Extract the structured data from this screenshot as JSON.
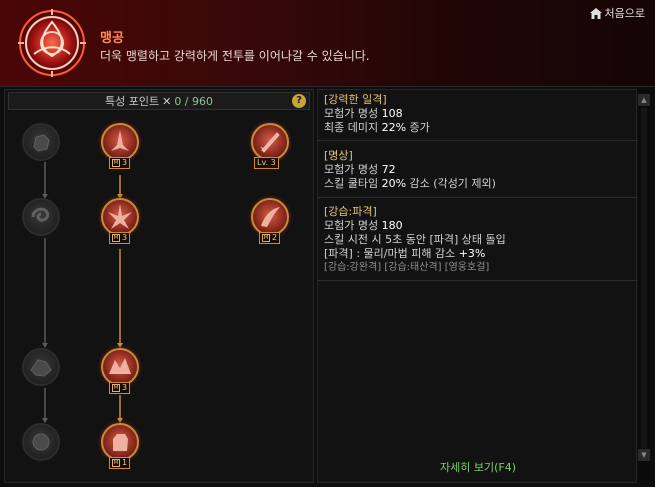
{
  "header": {
    "title": "맹공",
    "description": "더욱 맹렬하고 강력하게 전투를 이어나갈 수 있습니다.",
    "home_label": "처음으로"
  },
  "points": {
    "label": "특성 포인트",
    "value": "0 / 960",
    "help": "?"
  },
  "tree_nodes": [
    {
      "name": "gray-1-1",
      "state": "inactive"
    },
    {
      "name": "red-1-2",
      "state": "active",
      "badge": "3",
      "badge_prefix": "M"
    },
    {
      "name": "red-1-3",
      "state": "active",
      "badge": "Lv. 3"
    },
    {
      "name": "gray-2-1",
      "state": "inactive"
    },
    {
      "name": "red-2-2",
      "state": "active",
      "badge": "3",
      "badge_prefix": "M"
    },
    {
      "name": "red-2-3",
      "state": "active",
      "badge": "2",
      "badge_prefix": "M"
    },
    {
      "name": "gray-3-1",
      "state": "inactive"
    },
    {
      "name": "red-3-2",
      "state": "active",
      "badge": "3",
      "badge_prefix": "M"
    },
    {
      "name": "gray-4-1",
      "state": "inactive"
    },
    {
      "name": "red-4-2",
      "state": "active",
      "badge": "1",
      "badge_prefix": "M"
    }
  ],
  "skills": [
    {
      "name": "[강력한 일격]",
      "lines": [
        {
          "pre": "모험가 명성 ",
          "hl": "108",
          "post": ""
        },
        {
          "pre": "최종 데미지 ",
          "hl": "22%",
          "post": " 증가"
        }
      ]
    },
    {
      "name": "[명상]",
      "lines": [
        {
          "pre": "모험가 명성 ",
          "hl": "72",
          "post": ""
        },
        {
          "pre": "스킬 쿨타임 ",
          "hl": "20%",
          "post": " 감소 (각성기 제외)"
        }
      ]
    },
    {
      "name": "[강습:파격]",
      "lines": [
        {
          "pre": "모험가 명성 ",
          "hl": "180",
          "post": ""
        },
        {
          "pre": "스킬 시전 시 5초 동안 [파격] 상태 돌입",
          "hl": "",
          "post": ""
        },
        {
          "pre": "[파격] : 물리/마법 피해 감소 ",
          "hl": "+3%",
          "post": ""
        }
      ],
      "sub": "[강습:강완격] [강습:태산격] [영웅호걸]"
    }
  ],
  "detail_link": "자세히 보기(F4)",
  "colors": {
    "accent_gold": "#d28a2e",
    "link_green": "#7fd06e",
    "title_orange": "#ff8a5a"
  }
}
